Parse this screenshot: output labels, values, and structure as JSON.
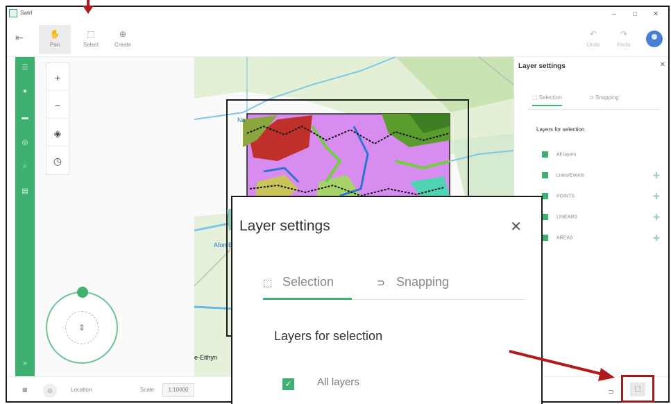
{
  "window": {
    "title": "Swirl",
    "controls": [
      "–",
      "□",
      "✕"
    ]
  },
  "toolbar": {
    "tools": [
      {
        "label": "Pan",
        "icon": "hand-icon"
      },
      {
        "label": "Select",
        "icon": "select-icon"
      },
      {
        "label": "Create",
        "icon": "create-icon"
      }
    ],
    "undo_label": "Undo",
    "redo_label": "Redo"
  },
  "map": {
    "labels": [
      "Na",
      "Afon E",
      "e-Eithyn"
    ],
    "zoom_controls": [
      "+",
      "−",
      "◈",
      "◷"
    ]
  },
  "statusbar": {
    "location_label": "Location",
    "scale_label": "Scale",
    "scale_value": "1:10000"
  },
  "panel": {
    "title": "Layer settings",
    "tabs": [
      "Selection",
      "Snapping"
    ],
    "subtitle": "Layers for selection",
    "layers": [
      "All layers",
      "Lines/Events",
      "POINTS",
      "LINEARS",
      "AREAS"
    ]
  },
  "callout": {
    "title": "Layer settings",
    "tabs": [
      "Selection",
      "Snapping"
    ],
    "subtitle": "Layers for selection",
    "layer": "All layers"
  },
  "colors": {
    "accent": "#3eb06f",
    "annotation_red": "#b01a1a",
    "area_pink": "#d98cf0",
    "area_red": "#c0302b"
  }
}
